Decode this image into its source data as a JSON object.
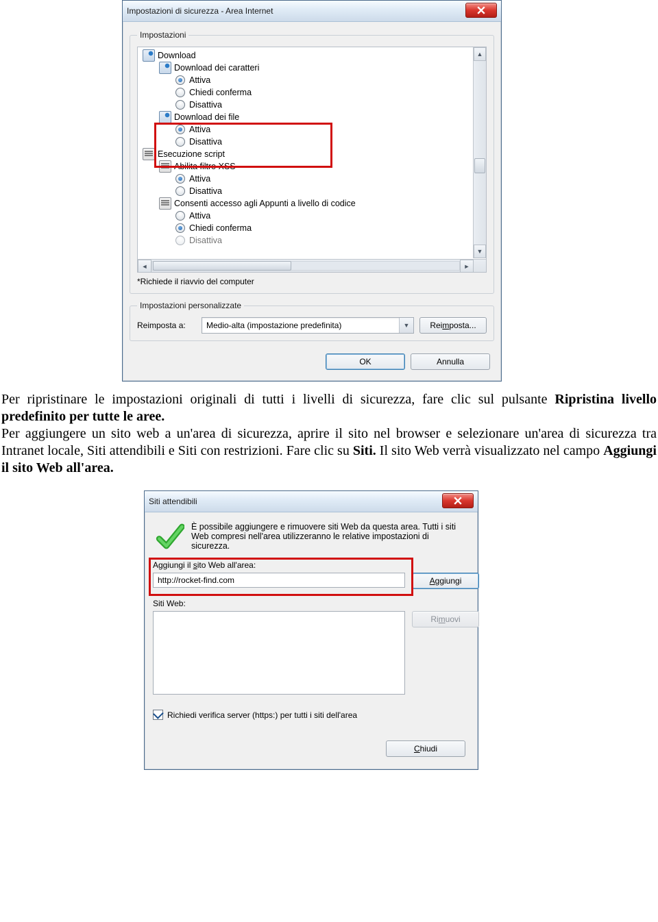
{
  "dialog1": {
    "title": "Impostazioni di sicurezza - Area Internet",
    "group_settings": "Impostazioni",
    "tree": {
      "download": {
        "label": "Download",
        "font": {
          "label": "Download dei caratteri",
          "opts": {
            "attiva": "Attiva",
            "chiedi": "Chiedi conferma",
            "disattiva": "Disattiva"
          },
          "selected": "attiva"
        },
        "file": {
          "label": "Download dei file",
          "opts": {
            "attiva": "Attiva",
            "disattiva": "Disattiva"
          },
          "selected": "attiva"
        }
      },
      "script": {
        "label": "Esecuzione script",
        "xss": {
          "label": "Abilita filtro XSS",
          "opts": {
            "attiva": "Attiva",
            "disattiva": "Disattiva"
          },
          "selected": "attiva"
        },
        "appunti": {
          "label": "Consenti accesso agli Appunti a livello di codice",
          "opts": {
            "attiva": "Attiva",
            "chiedi": "Chiedi conferma",
            "disattiva": "Disattiva"
          },
          "selected": "chiedi"
        }
      }
    },
    "restart_note": "*Richiede il riavvio del computer",
    "group_custom": "Impostazioni personalizzate",
    "reset_label": "Reimposta a:",
    "reset_value": "Medio-alta (impostazione predefinita)",
    "reset_btn_pre": "Rei",
    "reset_btn_u": "m",
    "reset_btn_post": "posta...",
    "ok": "OK",
    "cancel": "Annulla"
  },
  "doc": {
    "p1a": "Per ripristinare le impostazioni originali di tutti i livelli di sicurezza, fare clic sul pulsante ",
    "p1b": "Ripristina livello predefinito per tutte le aree.",
    "p2a": "Per aggiungere un sito web a un'area di sicurezza, aprire il sito nel browser e selezionare un'area di sicurezza tra Intranet locale, Siti attendibili e Siti con restrizioni. Fare clic su ",
    "p2b": "Siti.",
    "p2c": " Il sito Web verrà visualizzato nel campo ",
    "p2d": "Aggiungi il sito Web all'area."
  },
  "dialog2": {
    "title": "Siti attendibili",
    "desc": "È possibile aggiungere e rimuovere siti Web da questa area. Tutti i siti Web compresi nell'area utilizzeranno le relative impostazioni di sicurezza.",
    "add_label_pre": "Aggiungi il ",
    "add_label_u": "s",
    "add_label_post": "ito Web all'area:",
    "add_value": "http://rocket-find.com",
    "add_btn_pre": "",
    "add_btn_u": "A",
    "add_btn_post": "ggiungi",
    "sites_label": "Siti Web:",
    "remove_pre": "Ri",
    "remove_u": "m",
    "remove_post": "uovi",
    "https_check": "Richiedi verifica server (https:) per tutti i siti dell'area",
    "close_pre": "",
    "close_u": "C",
    "close_post": "hiudi"
  }
}
